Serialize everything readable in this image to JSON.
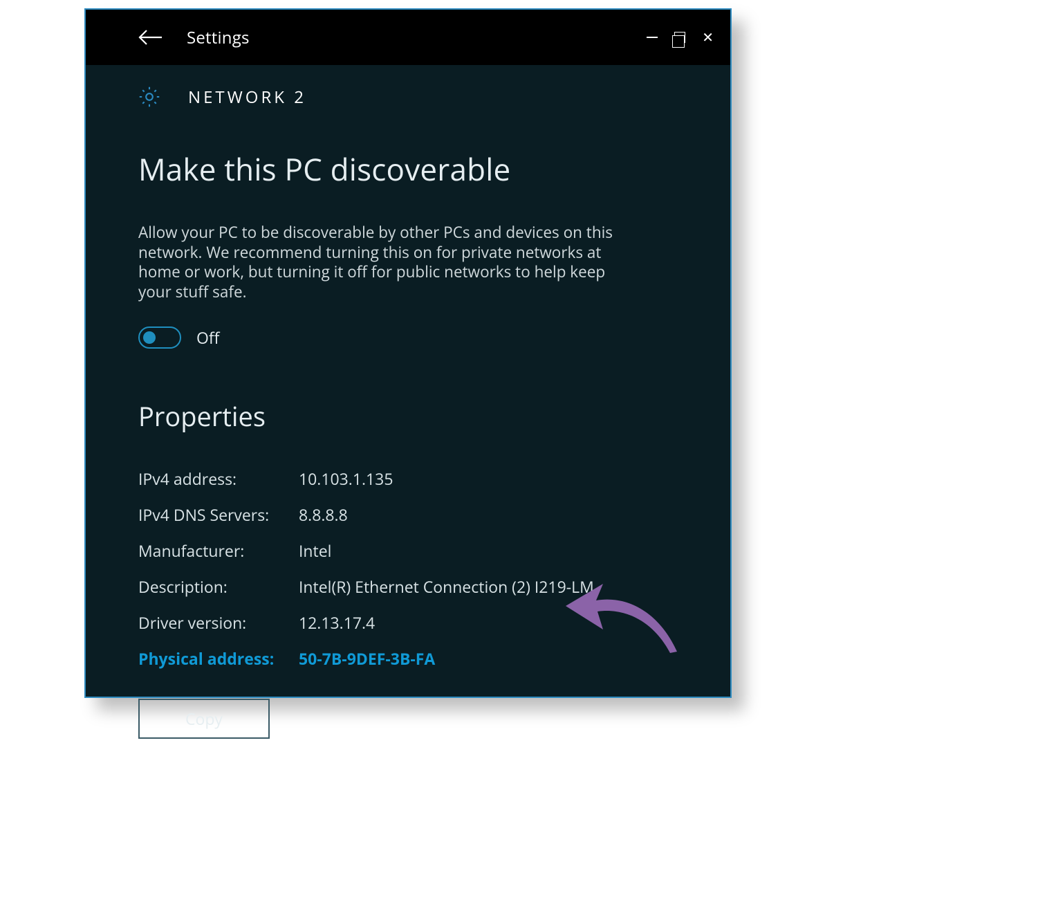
{
  "titlebar": {
    "app_title": "Settings"
  },
  "breadcrumb": {
    "text": "NETWORK   2"
  },
  "discoverable": {
    "heading": "Make this PC discoverable",
    "description": "Allow your PC to be discoverable by other PCs and devices on this network. We recommend turning this on for private networks at home or work, but turning it off for public networks to help keep your stuff safe.",
    "toggle_state_label": "Off"
  },
  "properties": {
    "heading": "Properties",
    "rows": [
      {
        "label": "IPv4 address:",
        "value": "10.103.1.135"
      },
      {
        "label": "IPv4 DNS Servers:",
        "value": "8.8.8.8"
      },
      {
        "label": "Manufacturer:",
        "value": "Intel"
      },
      {
        "label": "Description:",
        "value": "Intel(R) Ethernet Connection (2) I219-LM"
      },
      {
        "label": "Driver version:",
        "value": "12.13.17.4"
      },
      {
        "label": "Physical address:",
        "value": "50-7B-9DEF-3B-FA",
        "highlight": true
      }
    ],
    "copy_label": "Copy"
  }
}
